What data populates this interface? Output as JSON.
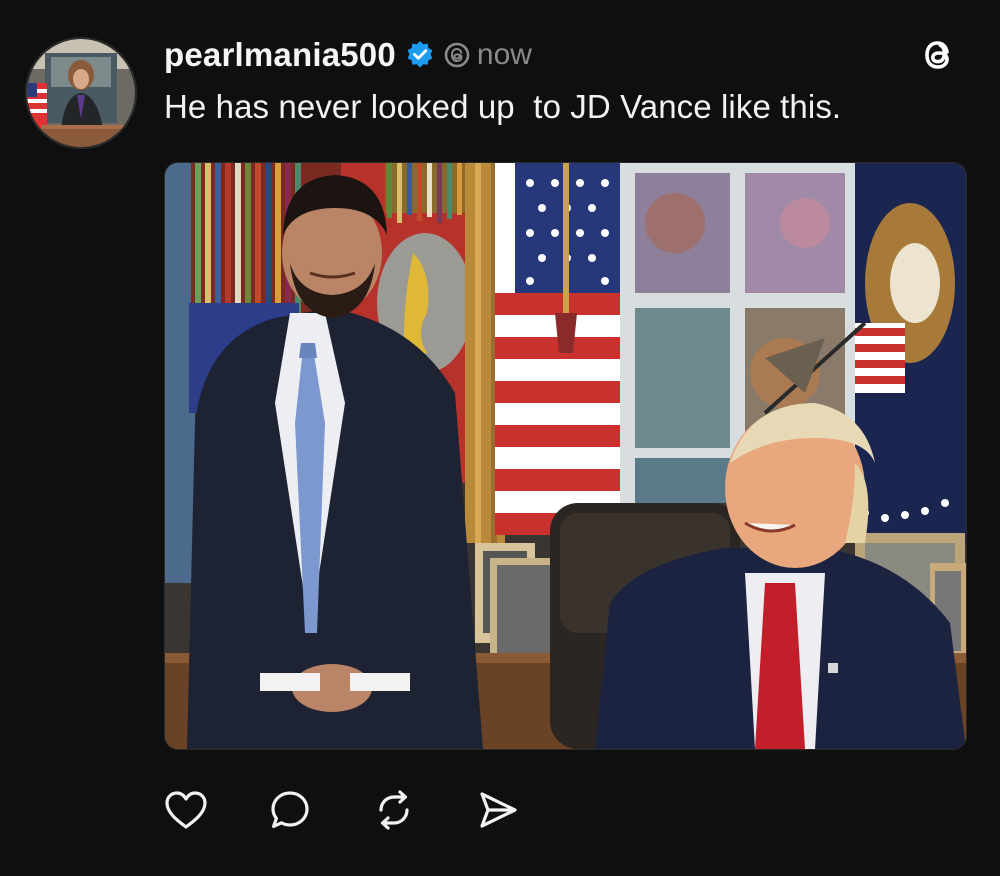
{
  "post": {
    "username": "pearlmania500",
    "verified": true,
    "timestamp": "now",
    "caption": "He has never looked up  to JD Vance like this."
  },
  "icons": {
    "verified": "verified-badge-icon",
    "threads_mini": "threads-logo-icon",
    "threads_corner": "threads-logo-icon",
    "like": "heart-icon",
    "reply": "comment-bubble-icon",
    "repost": "repost-icon",
    "share": "send-icon"
  },
  "colors": {
    "background": "#0f0f10",
    "text": "#f3f3f3",
    "muted": "#8a8a8a",
    "verified_blue": "#1d9bf0"
  }
}
